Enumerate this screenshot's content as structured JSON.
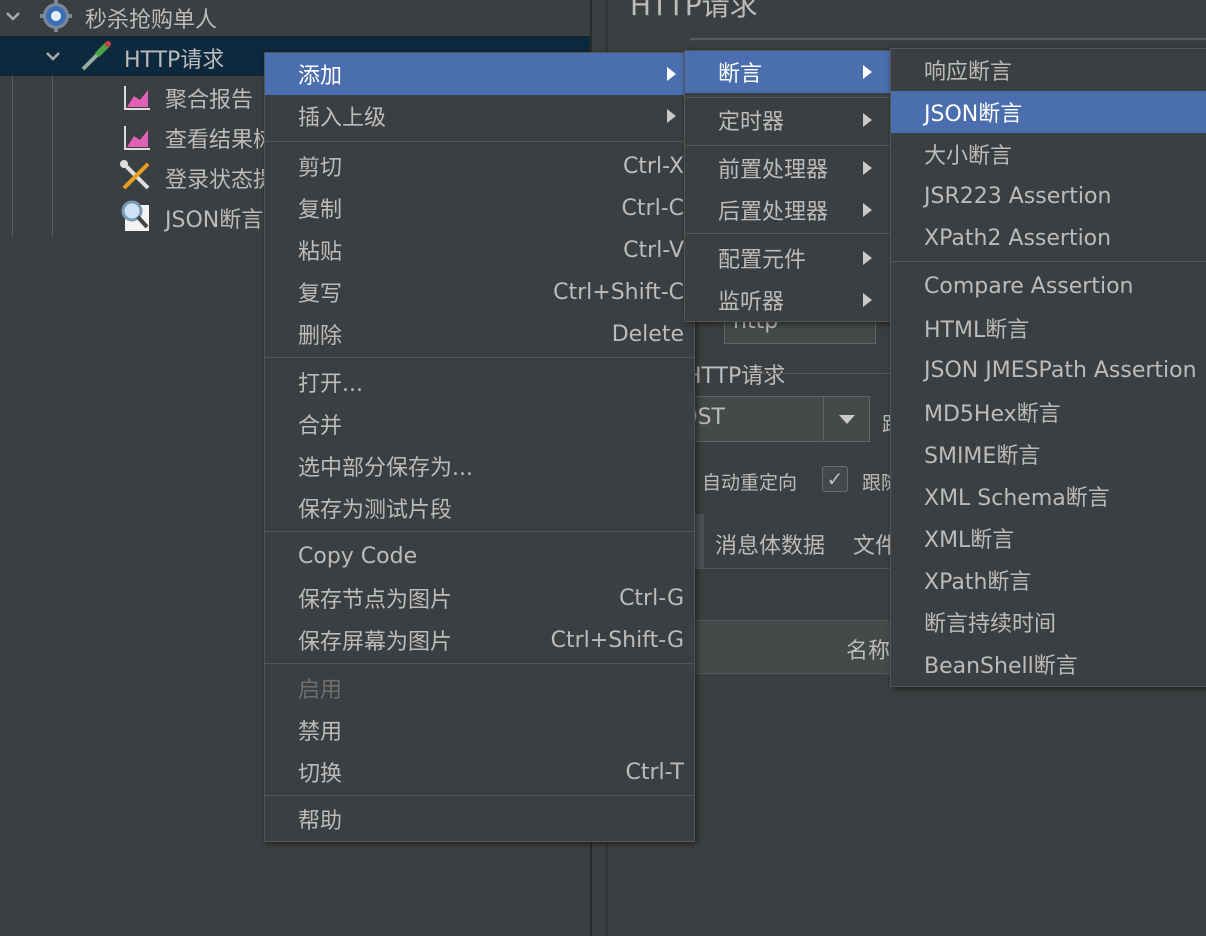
{
  "tree": {
    "root_label": "秒杀抢购单人",
    "http_label": "HTTP请求",
    "children": [
      "聚合报告",
      "查看结果树",
      "登录状态提取",
      "JSON断言"
    ]
  },
  "panel": {
    "title": "HTTP请求",
    "protocol_value": "http",
    "section_label": "HTTP请求",
    "method_value": "POST",
    "auto_redirect": "自动重定向",
    "follow_redirect": "跟随重定向",
    "tab_body": "消息体数据",
    "tab_files": "文件上传",
    "col_name": "名称"
  },
  "context_menu": {
    "add": "添加",
    "insert_parent": "插入上级",
    "cut": "剪切",
    "cut_key": "Ctrl-X",
    "copy": "复制",
    "copy_key": "Ctrl-C",
    "paste": "粘贴",
    "paste_key": "Ctrl-V",
    "duplicate": "复写",
    "duplicate_key": "Ctrl+Shift-C",
    "delete": "删除",
    "delete_key": "Delete",
    "open": "打开...",
    "merge": "合并",
    "save_selection": "选中部分保存为...",
    "save_fragment": "保存为测试片段",
    "copy_code": "Copy Code",
    "save_node_image": "保存节点为图片",
    "save_node_image_key": "Ctrl-G",
    "save_screen_image": "保存屏幕为图片",
    "save_screen_image_key": "Ctrl+Shift-G",
    "enable": "启用",
    "disable": "禁用",
    "toggle": "切换",
    "toggle_key": "Ctrl-T",
    "help": "帮助"
  },
  "add_submenu": {
    "assertions": "断言",
    "timers": "定时器",
    "pre_processors": "前置处理器",
    "post_processors": "后置处理器",
    "config_elements": "配置元件",
    "listeners": "监听器"
  },
  "assertion_submenu": [
    "响应断言",
    "JSON断言",
    "大小断言",
    "JSR223 Assertion",
    "XPath2 Assertion",
    "Compare Assertion",
    "HTML断言",
    "JSON JMESPath Assertion",
    "MD5Hex断言",
    "SMIME断言",
    "XML Schema断言",
    "XML断言",
    "XPath断言",
    "断言持续时间",
    "BeanShell断言"
  ],
  "colors": {
    "background": "#3c3f41",
    "highlight": "#4b6eaf",
    "tree_selected": "#0d293e",
    "text": "#bbbbbb"
  }
}
